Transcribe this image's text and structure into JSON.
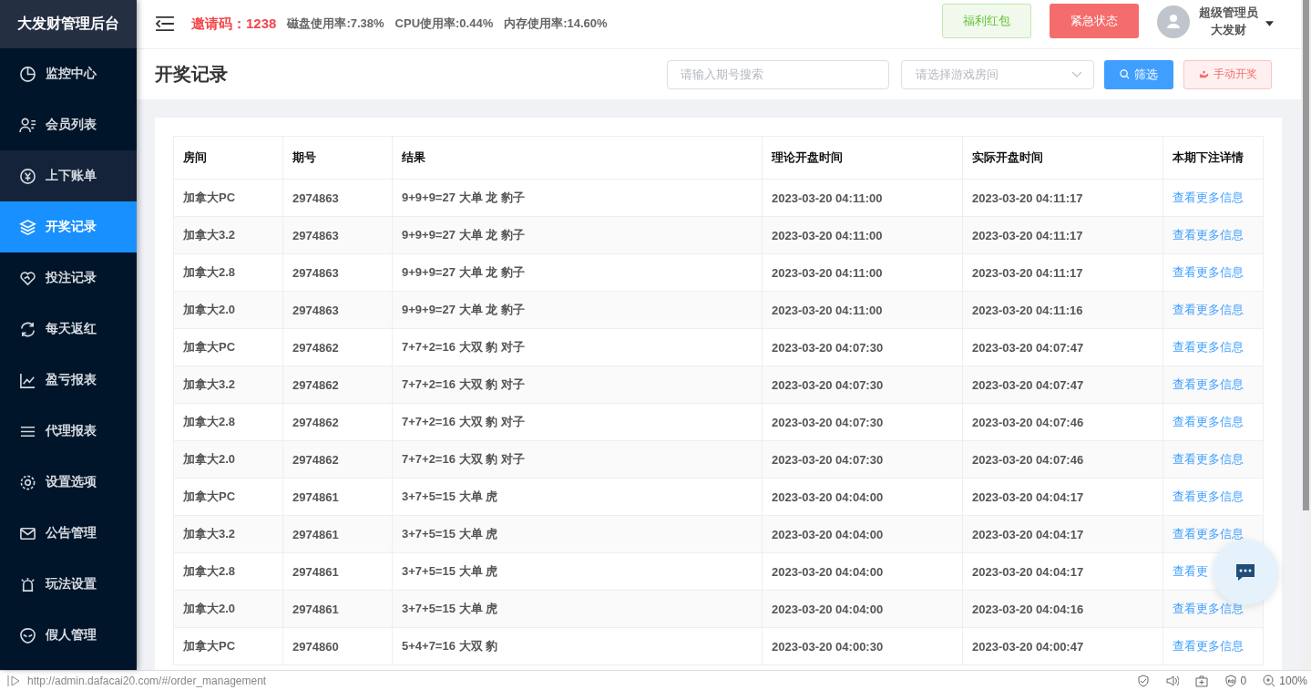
{
  "sidebar": {
    "title": "大发财管理后台",
    "items": [
      {
        "label": "监控中心",
        "selected": false,
        "highlighted": false
      },
      {
        "label": "会员列表",
        "selected": false,
        "highlighted": false
      },
      {
        "label": "上下账单",
        "selected": false,
        "highlighted": true
      },
      {
        "label": "开奖记录",
        "selected": true,
        "highlighted": false
      },
      {
        "label": "投注记录",
        "selected": false,
        "highlighted": false
      },
      {
        "label": "每天返红",
        "selected": false,
        "highlighted": false
      },
      {
        "label": "盈亏报表",
        "selected": false,
        "highlighted": false
      },
      {
        "label": "代理报表",
        "selected": false,
        "highlighted": false
      },
      {
        "label": "设置选项",
        "selected": false,
        "highlighted": false
      },
      {
        "label": "公告管理",
        "selected": false,
        "highlighted": false
      },
      {
        "label": "玩法设置",
        "selected": false,
        "highlighted": false
      },
      {
        "label": "假人管理",
        "selected": false,
        "highlighted": false
      }
    ]
  },
  "header": {
    "invite_label": "邀请码：",
    "invite_code": "1238",
    "stats": [
      "磁盘使用率:7.38%",
      "CPU使用率:0.44%",
      "内存使用率:14.60%"
    ],
    "bonus_button": "福利红包",
    "emergency_button": "紧急状态",
    "user_role": "超级管理员",
    "user_name": "大发财"
  },
  "page": {
    "title": "开奖记录",
    "search": {
      "placeholder": "请输入期号搜索"
    },
    "room_select": {
      "placeholder": "请选择游戏房间"
    },
    "filter_button": "筛选",
    "manual_button": "手动开奖"
  },
  "table": {
    "columns": [
      "房间",
      "期号",
      "结果",
      "理论开盘时间",
      "实际开盘时间",
      "本期下注详情"
    ],
    "rows": [
      [
        "加拿大PC",
        "2974863",
        "9+9+9=27 大单 龙 豹子",
        "2023-03-20 04:11:00",
        "2023-03-20 04:11:17",
        "查看更多信息"
      ],
      [
        "加拿大3.2",
        "2974863",
        "9+9+9=27 大单 龙 豹子",
        "2023-03-20 04:11:00",
        "2023-03-20 04:11:17",
        "查看更多信息"
      ],
      [
        "加拿大2.8",
        "2974863",
        "9+9+9=27 大单 龙 豹子",
        "2023-03-20 04:11:00",
        "2023-03-20 04:11:17",
        "查看更多信息"
      ],
      [
        "加拿大2.0",
        "2974863",
        "9+9+9=27 大单 龙 豹子",
        "2023-03-20 04:11:00",
        "2023-03-20 04:11:16",
        "查看更多信息"
      ],
      [
        "加拿大PC",
        "2974862",
        "7+7+2=16 大双 豹 对子",
        "2023-03-20 04:07:30",
        "2023-03-20 04:07:47",
        "查看更多信息"
      ],
      [
        "加拿大3.2",
        "2974862",
        "7+7+2=16 大双 豹 对子",
        "2023-03-20 04:07:30",
        "2023-03-20 04:07:47",
        "查看更多信息"
      ],
      [
        "加拿大2.8",
        "2974862",
        "7+7+2=16 大双 豹 对子",
        "2023-03-20 04:07:30",
        "2023-03-20 04:07:46",
        "查看更多信息"
      ],
      [
        "加拿大2.0",
        "2974862",
        "7+7+2=16 大双 豹 对子",
        "2023-03-20 04:07:30",
        "2023-03-20 04:07:46",
        "查看更多信息"
      ],
      [
        "加拿大PC",
        "2974861",
        "3+7+5=15 大单 虎",
        "2023-03-20 04:04:00",
        "2023-03-20 04:04:17",
        "查看更多信息"
      ],
      [
        "加拿大3.2",
        "2974861",
        "3+7+5=15 大单 虎",
        "2023-03-20 04:04:00",
        "2023-03-20 04:04:17",
        "查看更多信息"
      ],
      [
        "加拿大2.8",
        "2974861",
        "3+7+5=15 大单 虎",
        "2023-03-20 04:04:00",
        "2023-03-20 04:04:17",
        "查看更"
      ],
      [
        "加拿大2.0",
        "2974861",
        "3+7+5=15 大单 虎",
        "2023-03-20 04:04:00",
        "2023-03-20 04:04:16",
        "查看更多信息"
      ],
      [
        "加拿大PC",
        "2974860",
        "5+4+7=16 大双 豹",
        "2023-03-20 04:00:30",
        "2023-03-20 04:00:47",
        "查看更多信息"
      ]
    ]
  },
  "status_bar": {
    "url": "http://admin.dafacai20.com/#/order_management",
    "ad_count": "0",
    "zoom": "100%"
  }
}
